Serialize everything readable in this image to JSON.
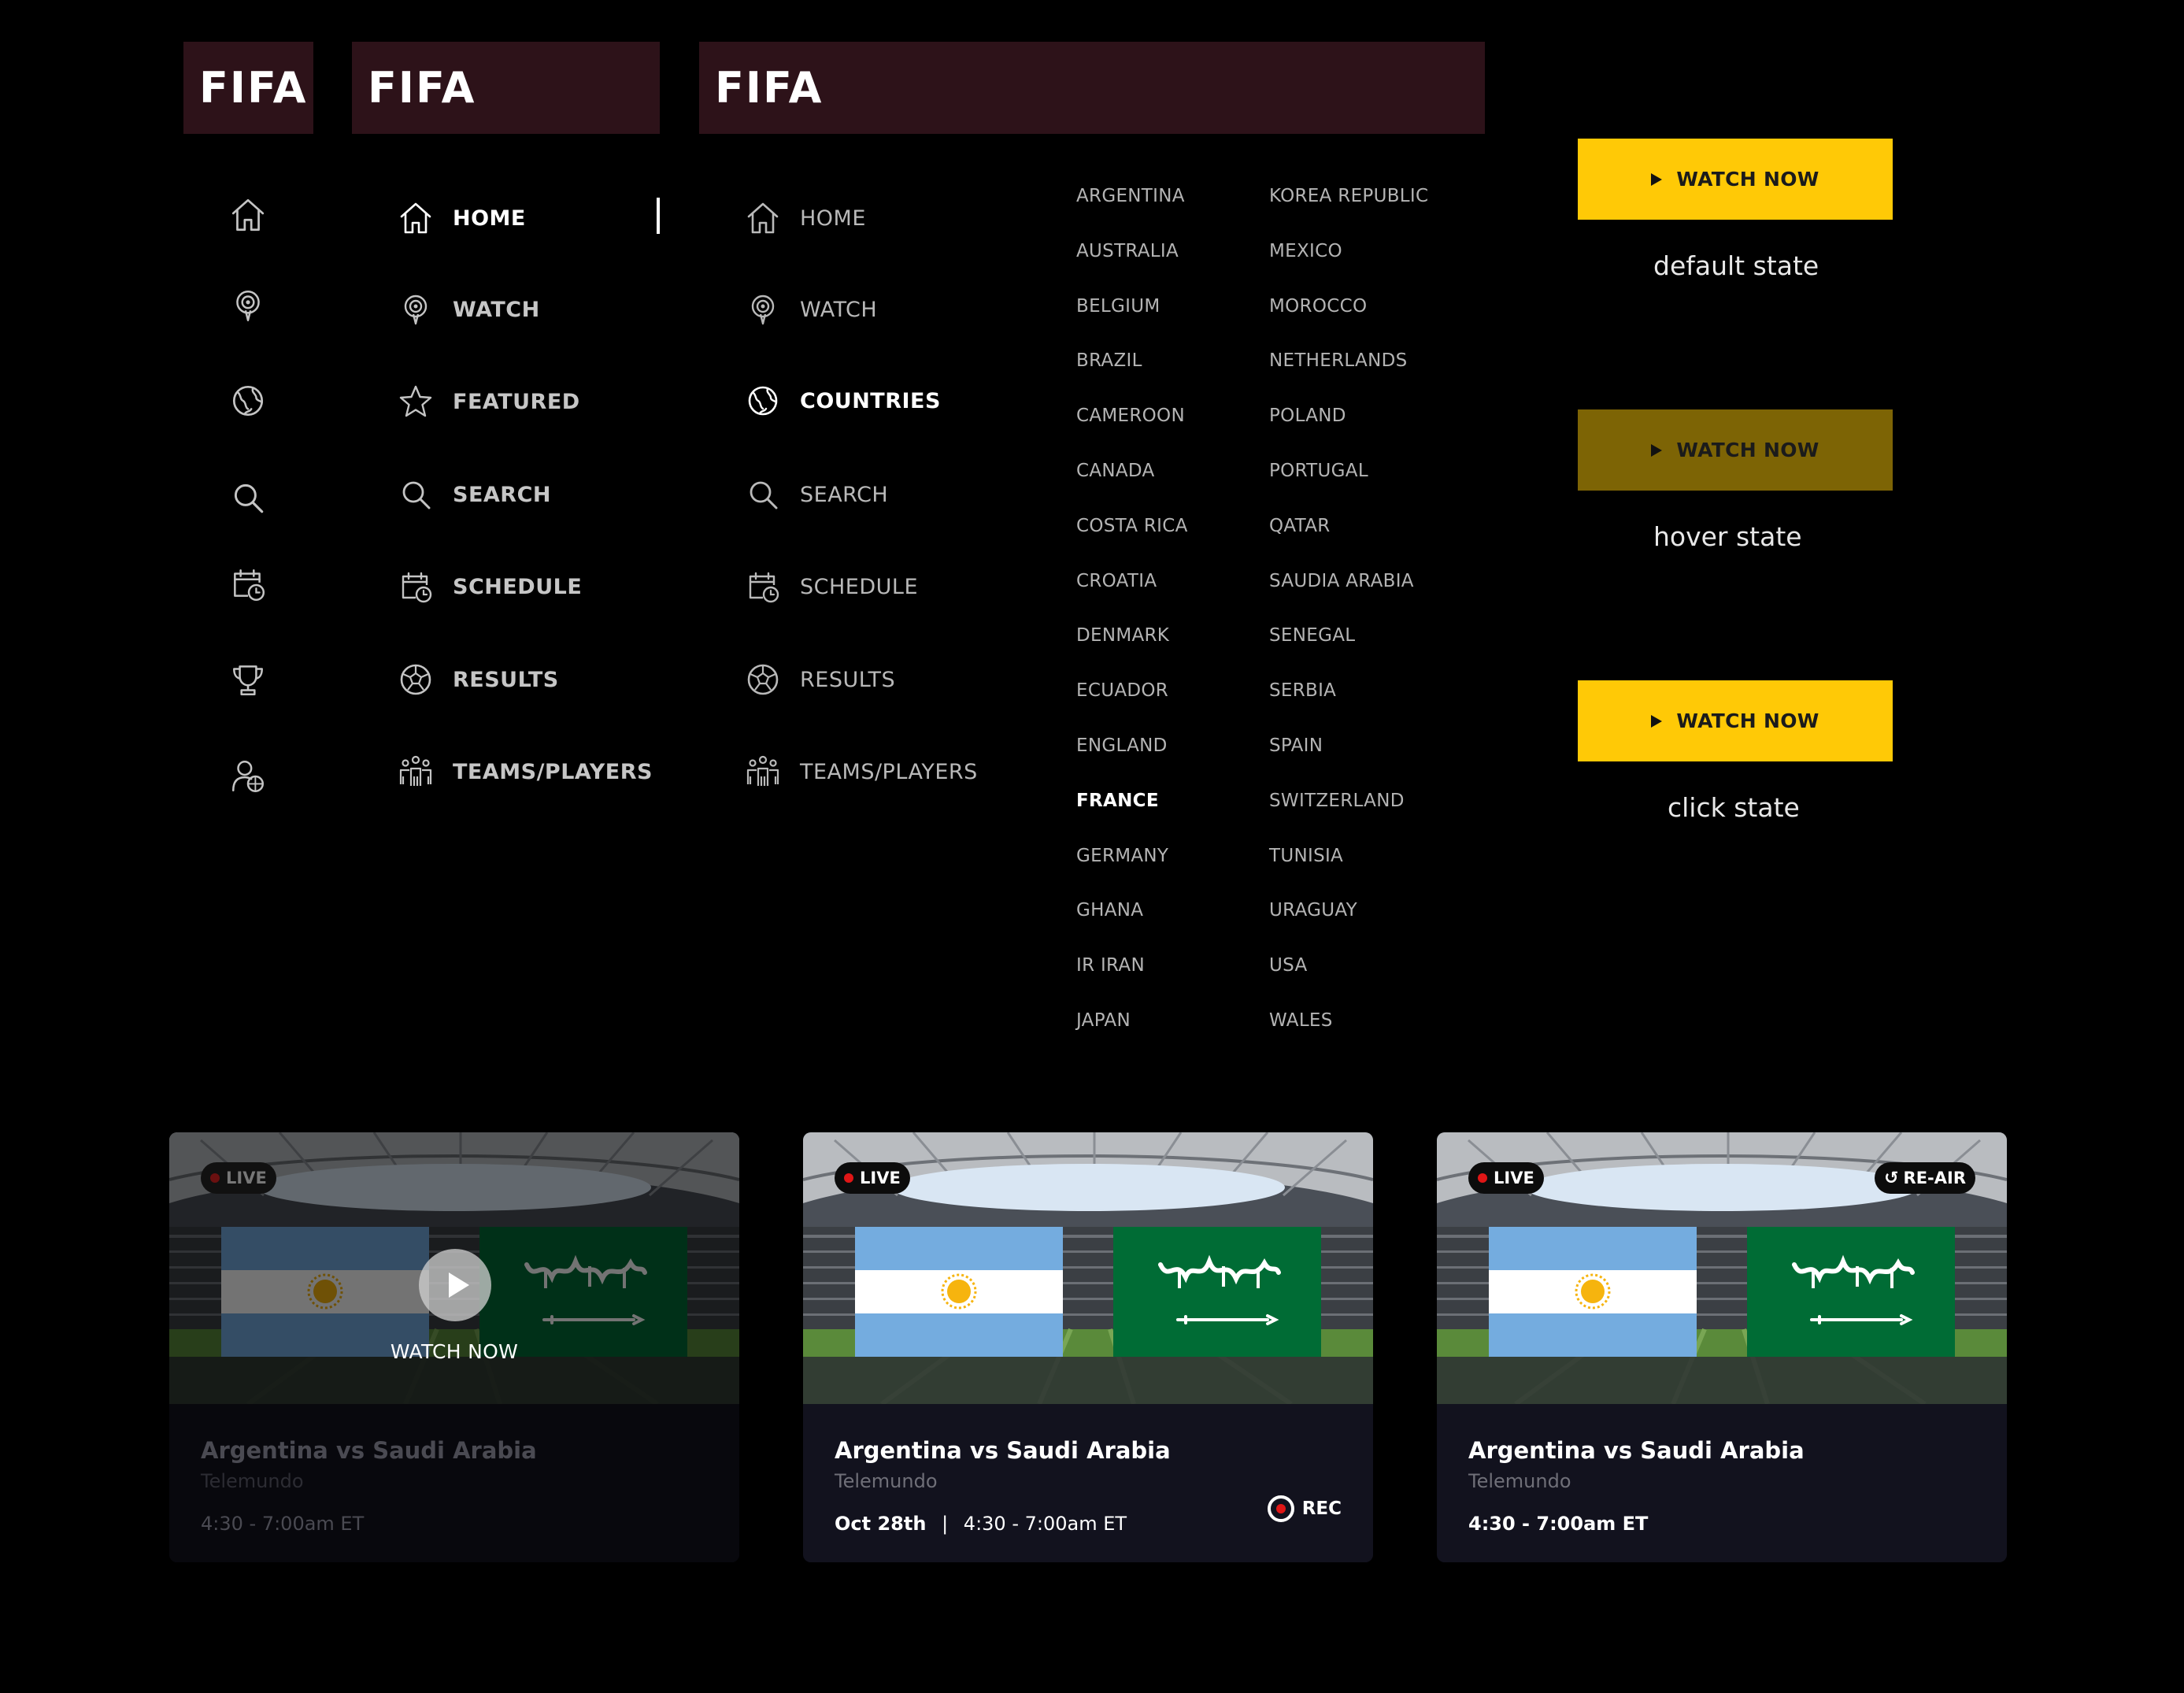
{
  "brand": {
    "logo": "FIFA"
  },
  "icon_rail": [
    "home-icon",
    "watch-icon",
    "globe-icon",
    "search-icon",
    "schedule-icon",
    "trophy-icon",
    "teams-icon"
  ],
  "nav_b": {
    "items": [
      {
        "label": "HOME",
        "icon": "home-icon"
      },
      {
        "label": "WATCH",
        "icon": "watch-icon"
      },
      {
        "label": "FEATURED",
        "icon": "star-icon"
      },
      {
        "label": "SEARCH",
        "icon": "search-icon"
      },
      {
        "label": "SCHEDULE",
        "icon": "schedule-icon"
      },
      {
        "label": "RESULTS",
        "icon": "soccer-ball-icon"
      },
      {
        "label": "TEAMS/PLAYERS",
        "icon": "teams-icon"
      }
    ],
    "active": "HOME"
  },
  "nav_c": {
    "items": [
      {
        "label": "HOME",
        "icon": "home-icon"
      },
      {
        "label": "WATCH",
        "icon": "watch-icon"
      },
      {
        "label": "COUNTRIES",
        "icon": "globe-icon"
      },
      {
        "label": "SEARCH",
        "icon": "search-icon"
      },
      {
        "label": "SCHEDULE",
        "icon": "schedule-icon"
      },
      {
        "label": "RESULTS",
        "icon": "soccer-ball-icon"
      },
      {
        "label": "TEAMS/PLAYERS",
        "icon": "teams-icon"
      }
    ],
    "active": "COUNTRIES"
  },
  "countries": {
    "col1": [
      "ARGENTINA",
      "AUSTRALIA",
      "BELGIUM",
      "BRAZIL",
      "CAMEROON",
      "CANADA",
      "COSTA RICA",
      "CROATIA",
      "DENMARK",
      "ECUADOR",
      "ENGLAND",
      "FRANCE",
      "GERMANY",
      "GHANA",
      "IR IRAN",
      "JAPAN"
    ],
    "col2": [
      "KOREA REPUBLIC",
      "MEXICO",
      "MOROCCO",
      "NETHERLANDS",
      "POLAND",
      "PORTUGAL",
      "QATAR",
      "SAUDIA ARABIA",
      "SENEGAL",
      "SERBIA",
      "SPAIN",
      "SWITZERLAND",
      "TUNISIA",
      "URAGUAY",
      "USA",
      "WALES"
    ],
    "selected": "FRANCE"
  },
  "watch_buttons": [
    {
      "label": "WATCH NOW",
      "caption": "default state",
      "color": "#ffc906"
    },
    {
      "label": "WATCH NOW",
      "caption": "hover state",
      "color": "#7d6405"
    },
    {
      "label": "WATCH NOW",
      "caption": "click state",
      "color": "#ffc906"
    }
  ],
  "cards": [
    {
      "live_badge": "LIVE",
      "title": "Argentina vs Saudi Arabia",
      "channel": "Telemundo",
      "time": "4:30 - 7:00am ET",
      "overlay_label": "WATCH NOW"
    },
    {
      "live_badge": "LIVE",
      "title": "Argentina vs Saudi Arabia",
      "channel": "Telemundo",
      "date": "Oct 28th",
      "separator": "|",
      "time": "4:30 - 7:00am ET",
      "rec_label": "REC"
    },
    {
      "live_badge": "LIVE",
      "reair_badge": "RE-AIR",
      "title": "Argentina vs Saudi Arabia",
      "channel": "Telemundo",
      "time": "4:30 - 7:00am ET"
    }
  ],
  "colors": {
    "header_bg": "#2d1219",
    "accent_yellow": "#ffc906",
    "hover_yellow": "#7d6405",
    "live_red": "#e01616",
    "card_bg": "#12121e"
  }
}
